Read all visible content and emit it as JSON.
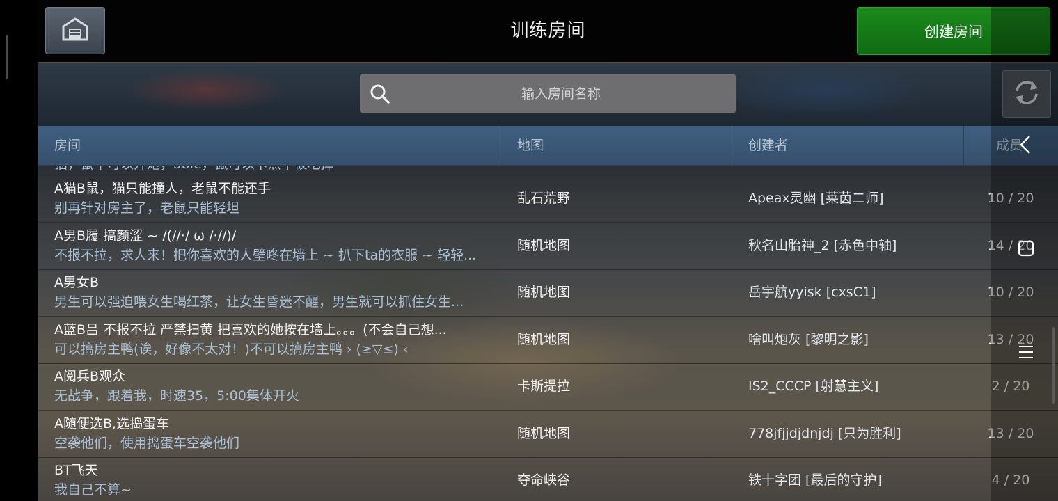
{
  "header": {
    "title": "训练房间",
    "home_icon": "garage-home-icon",
    "create_button": "创建房间",
    "create_color": "#158a18"
  },
  "search": {
    "placeholder": "输入房间名称",
    "icon": "search-icon"
  },
  "refresh_icon": "refresh-icon",
  "table": {
    "columns": [
      "房间",
      "地图",
      "创建者",
      "成员"
    ],
    "rows": [
      {
        "name": "",
        "desc": "猫，鼠不可以开炮，able，鼠可以卡点不被吃掉",
        "map": "",
        "creator": "",
        "members": ""
      },
      {
        "name": "A猫B鼠，猫只能撞人，老鼠不能还手",
        "desc": "别再针对房主了，老鼠只能轻坦",
        "map": "乱石荒野",
        "creator": "Apeax灵幽 [莱茵二师]",
        "members": "10 / 20"
      },
      {
        "name": "A男B履 搞颜涩 ~ /(//·/ ω /·//)/",
        "desc": "不报不拉，求人来！把你喜欢的人壁咚在墙上 ~ 扒下ta的衣服 ~ 轻轻...",
        "map": "随机地图",
        "creator": "秋名山胎神_2 [赤色中轴]",
        "members": "14 / 20"
      },
      {
        "name": "A男女B",
        "desc": "男生可以强迫喂女生喝红茶，让女生昏迷不醒，男生就可以抓住女生...",
        "map": "随机地图",
        "creator": "岳宇航yyisk [cxsC1]",
        "members": "10 / 20"
      },
      {
        "name": "A蓝B吕 不报不拉 严禁扫黄 把喜欢的她按在墙上。。。(不会自己想...",
        "desc": "可以搞房主鸭(诶，好像不太对！)不可以搞房主鸭 › (≥▽≤) ‹",
        "map": "随机地图",
        "creator": "啥叫炮灰 [黎明之影]",
        "members": "13 / 20"
      },
      {
        "name": "A阅兵B观众",
        "desc": "无战争，跟着我，时速35，5:00集体开火",
        "map": "卡斯提拉",
        "creator": "IS2_CCCP [射慧主义]",
        "members": "2 / 20"
      },
      {
        "name": "A随便选B,选捣蛋车",
        "desc": "空袭他们，使用捣蛋车空袭他们",
        "map": "随机地图",
        "creator": "778jfjjdjdnjdj [只为胜利]",
        "members": "13 / 20"
      },
      {
        "name": "BT飞天",
        "desc": "我自己不算~",
        "map": "夺命峡谷",
        "creator": "铁十字团 [最后的守护]",
        "members": "4 / 20"
      }
    ]
  },
  "nav_icons": [
    "back-icon",
    "recent-apps-icon",
    "menu-icon"
  ]
}
